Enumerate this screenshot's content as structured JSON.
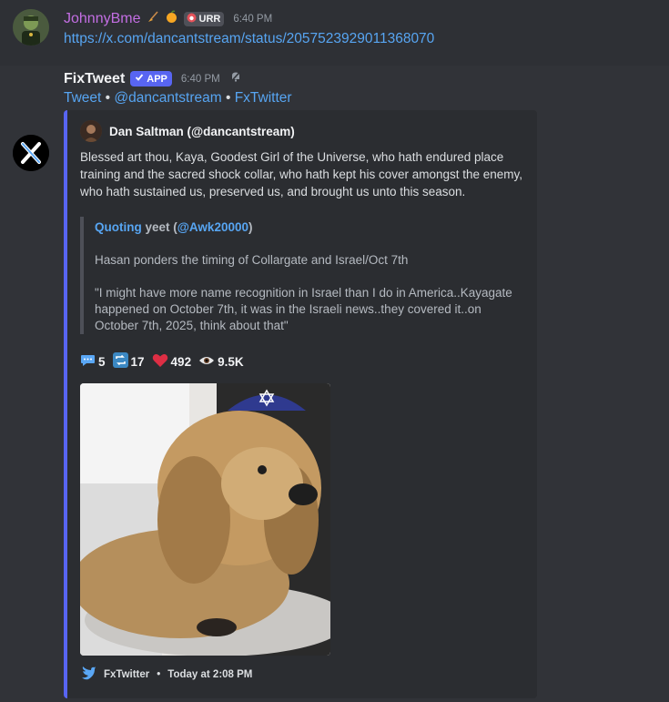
{
  "message1": {
    "username": "JohnnyBme",
    "username_color": "#c36ee3",
    "role_icons": [
      "broom-icon",
      "peach-icon"
    ],
    "tag": "URR",
    "timestamp": "6:40 PM",
    "link": "https://x.com/dancantstream/status/2057523929011368070"
  },
  "message2": {
    "username": "FixTweet",
    "badge": "APP",
    "timestamp": "6:40 PM",
    "links": {
      "tweet": "Tweet",
      "sep1": " • ",
      "handle": "@dancantstream",
      "sep2": " • ",
      "fxtwitter": "FxTwitter"
    },
    "embed": {
      "accent_color": "#5865f2",
      "author": "Dan Saltman (@dancantstream)",
      "description": "Blessed art thou, Kaya, Goodest Girl of the Universe, who hath endured place training and the sacred shock collar, who hath kept his cover amongst the enemy, who hath sustained us, preserved us, and brought us unto this season.",
      "quote": {
        "label": "Quoting",
        "name": " yeet (",
        "handle": "@Awk20000",
        "close": ")",
        "line1": "Hasan ponders the timing of Collargate and Israel/Oct 7th",
        "line2": "\"I might have more name recognition in Israel than I do in America..Kayagate happened on October 7th, it was in the Israeli news..they covered it..on October 7th, 2025, think about that\""
      },
      "stats": {
        "replies": "5",
        "retweets": "17",
        "likes": "492",
        "views": "9.5K"
      },
      "footer": {
        "source": "FxTwitter",
        "sep": " • ",
        "time": "Today at 2:08 PM"
      }
    }
  }
}
